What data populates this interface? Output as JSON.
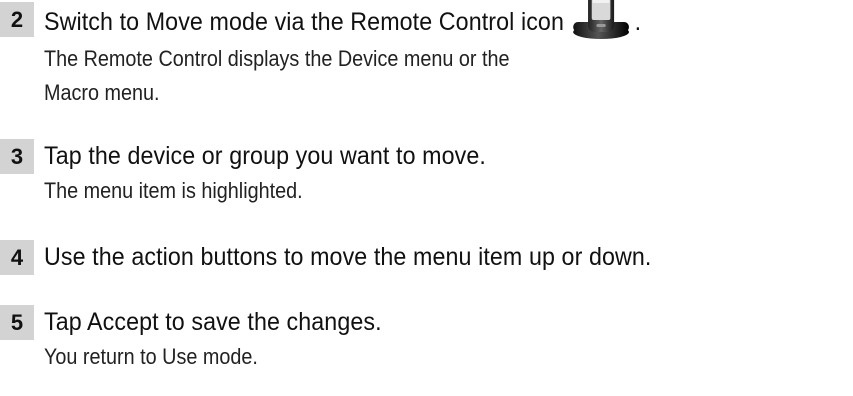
{
  "steps": [
    {
      "number": "2",
      "instruction": "Switch to Move mode via the Remote Control icon",
      "trailing": ".",
      "icon": "remote-control-icon",
      "result_lines": [
        "The Remote Control displays the Device menu or the",
        "Macro menu."
      ]
    },
    {
      "number": "3",
      "instruction": "Tap the device or group you want to move.",
      "result_lines": [
        "The menu item is highlighted."
      ]
    },
    {
      "number": "4",
      "instruction": "Use the action buttons to move the menu item up or down.",
      "result_lines": []
    },
    {
      "number": "5",
      "instruction": "Tap Accept to save the changes.",
      "result_lines": [
        "You return to Use mode."
      ]
    }
  ]
}
